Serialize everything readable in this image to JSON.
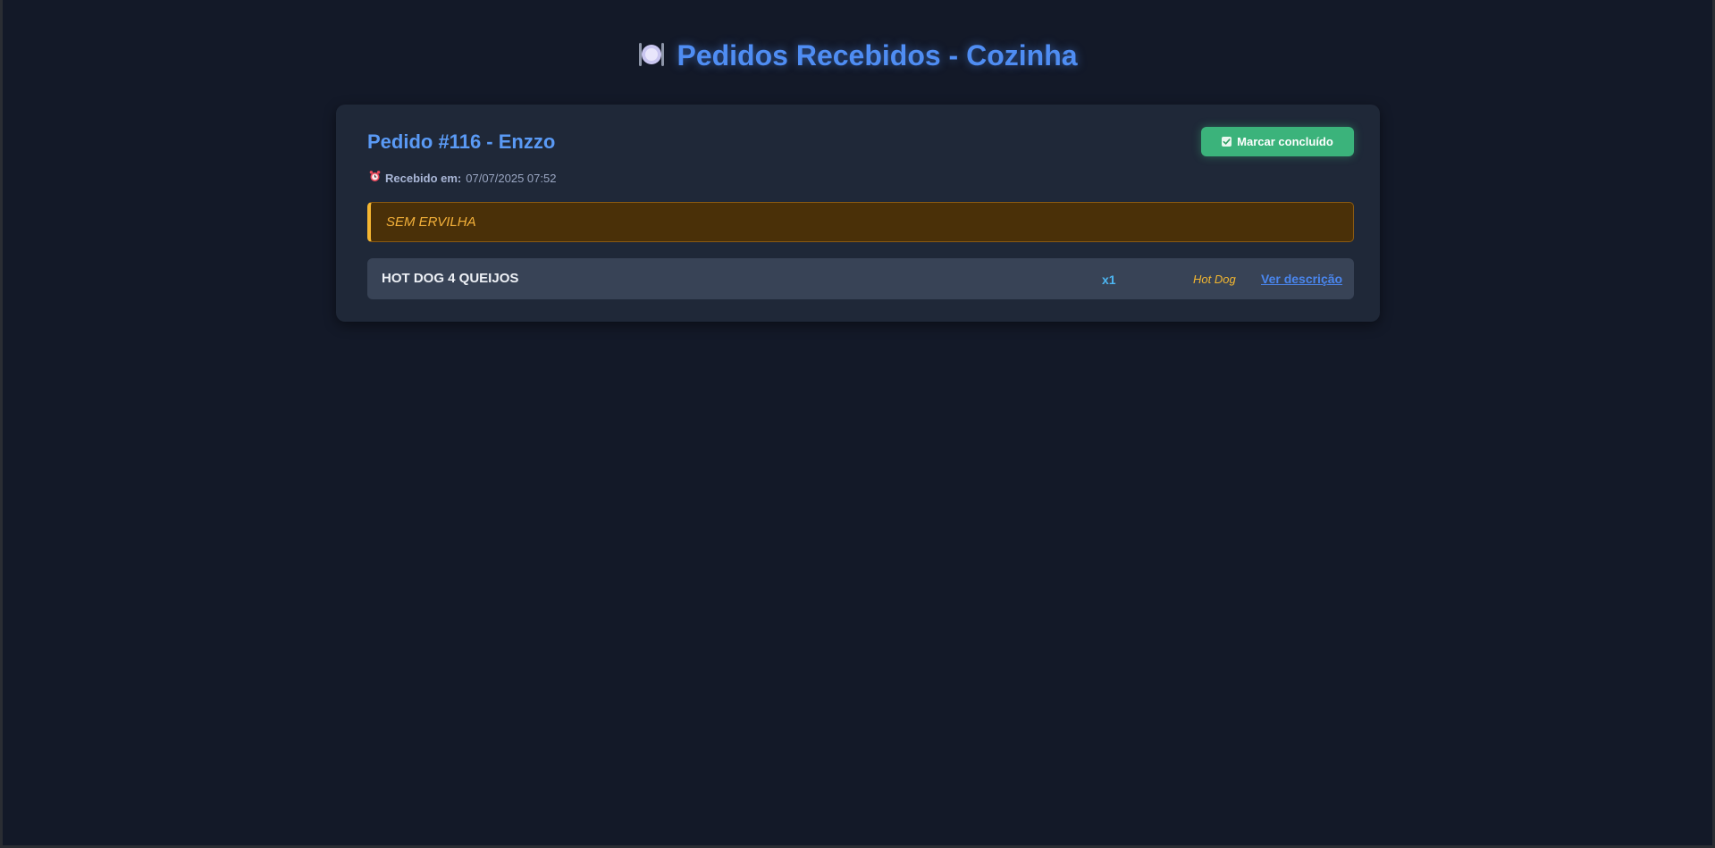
{
  "header": {
    "icon": "plate-cutlery-icon",
    "title": "Pedidos Recebidos - Cozinha"
  },
  "order": {
    "title": "Pedido #116 - Enzzo",
    "done_button_icon": "check-box-icon",
    "done_button_label": "Marcar concluído",
    "received_icon": "alarm-clock-icon",
    "received_label": "Recebido em:",
    "received_value": "07/07/2025 07:52",
    "note": "SEM ERVILHA",
    "items": [
      {
        "name": "HOT DOG 4 QUEIJOS",
        "quantity": "x1",
        "category": "Hot Dog",
        "link_label": "Ver descrição"
      }
    ]
  },
  "colors": {
    "background": "#131928",
    "card": "#1f2838",
    "accent": "#4f8df3",
    "success": "#3bb37b",
    "warning": "#f5b631",
    "quantity": "#4db6f2"
  }
}
